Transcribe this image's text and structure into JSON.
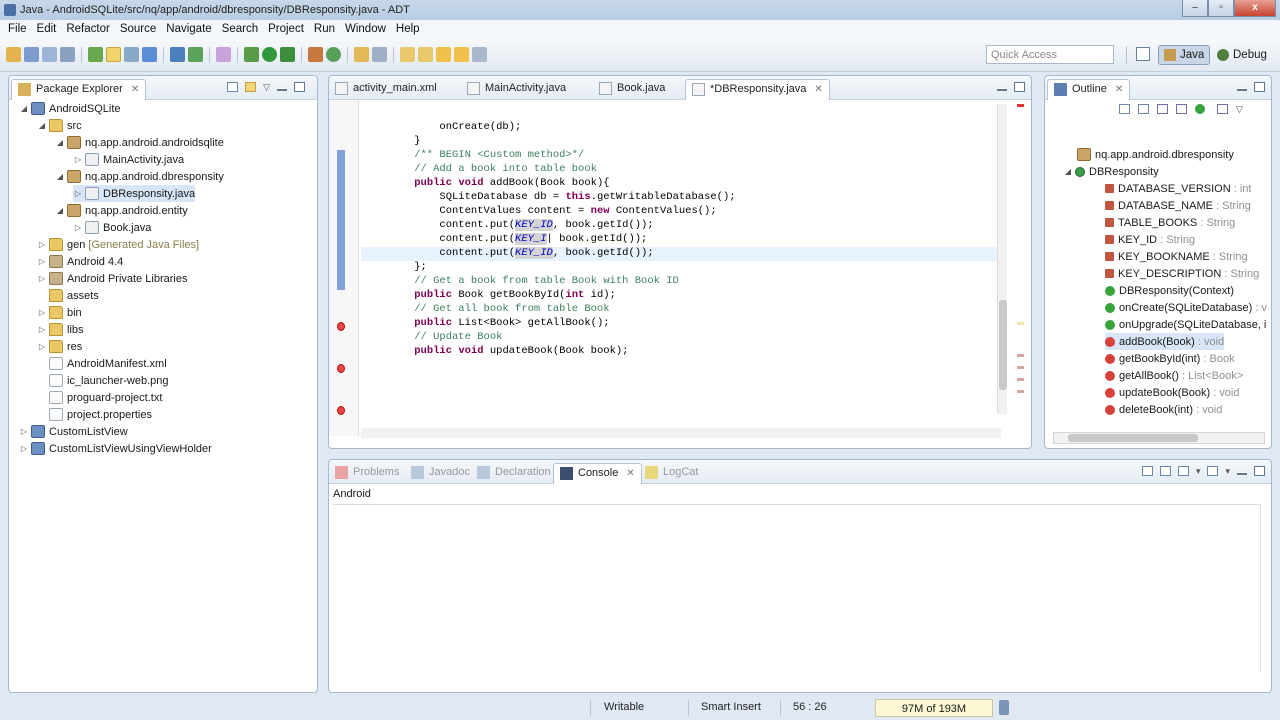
{
  "window": {
    "title": "Java - AndroidSQLite/src/nq/app/android/dbresponsity/DBResponsity.java - ADT",
    "controls": [
      "–",
      "▫",
      "x"
    ]
  },
  "menu": [
    "File",
    "Edit",
    "Refactor",
    "Source",
    "Navigate",
    "Search",
    "Project",
    "Run",
    "Window",
    "Help"
  ],
  "toolbar": {
    "quick_access_placeholder": "Quick Access",
    "perspective_java": "Java",
    "perspective_debug": "Debug"
  },
  "explorer": {
    "title": "Package Explorer",
    "items": [
      {
        "label": "AndroidSQLite",
        "extra": ""
      },
      {
        "label": "src",
        "extra": ""
      },
      {
        "label": "nq.app.android.androidsqlite",
        "extra": ""
      },
      {
        "label": "MainActivity.java",
        "extra": ""
      },
      {
        "label": "nq.app.android.dbresponsity",
        "extra": ""
      },
      {
        "label": "DBResponsity.java",
        "extra": ""
      },
      {
        "label": "nq.app.android.entity",
        "extra": ""
      },
      {
        "label": "Book.java",
        "extra": ""
      },
      {
        "label": "gen",
        "extra": "[Generated Java Files]"
      },
      {
        "label": "Android 4.4",
        "extra": ""
      },
      {
        "label": "Android Private Libraries",
        "extra": ""
      },
      {
        "label": "assets",
        "extra": ""
      },
      {
        "label": "bin",
        "extra": ""
      },
      {
        "label": "libs",
        "extra": ""
      },
      {
        "label": "res",
        "extra": ""
      },
      {
        "label": "AndroidManifest.xml",
        "extra": ""
      },
      {
        "label": "ic_launcher-web.png",
        "extra": ""
      },
      {
        "label": "proguard-project.txt",
        "extra": ""
      },
      {
        "label": "project.properties",
        "extra": ""
      },
      {
        "label": "CustomListView",
        "extra": ""
      },
      {
        "label": "CustomListViewUsingViewHolder",
        "extra": ""
      }
    ]
  },
  "editor": {
    "tabs": [
      "activity_main.xml",
      "MainActivity.java",
      "Book.java",
      "*DBResponsity.java"
    ],
    "lines": [
      "        onCreate(db);",
      "    }",
      "",
      "    /** BEGIN <Custom method>*/",
      "    // Add a book into table book",
      "    public void addBook(Book book){",
      "        SQLiteDatabase db = this.getWritableDatabase();",
      "",
      "        ContentValues content = new ContentValues();",
      "        content.put(KEY_ID, book.getId());",
      "        content.put(KEY_I| book.getId());",
      "        content.put(KEY_ID, book.getId());",
      "    };",
      "",
      "    // Get a book from table Book with Book ID",
      "    public Book getBookById(int id);",
      "",
      "    // Get all book from table Book",
      "    public List<Book> getAllBook();",
      "",
      "    // Update Book",
      "    public void updateBook(Book book);"
    ]
  },
  "outline": {
    "title": "Outline",
    "items": [
      {
        "label": "nq.app.android.dbresponsity",
        "type": ""
      },
      {
        "label": "DBResponsity",
        "type": ""
      },
      {
        "label": "DATABASE_VERSION",
        "type": ": int"
      },
      {
        "label": "DATABASE_NAME",
        "type": ": String"
      },
      {
        "label": "TABLE_BOOKS",
        "type": ": String"
      },
      {
        "label": "KEY_ID",
        "type": ": String"
      },
      {
        "label": "KEY_BOOKNAME",
        "type": ": String"
      },
      {
        "label": "KEY_DESCRIPTION",
        "type": ": String"
      },
      {
        "label": "DBResponsity(Context)",
        "type": ""
      },
      {
        "label": "onCreate(SQLiteDatabase)",
        "type": ": v"
      },
      {
        "label": "onUpgrade(SQLiteDatabase, i",
        "type": ""
      },
      {
        "label": "addBook(Book)",
        "type": ": void"
      },
      {
        "label": "getBookById(int)",
        "type": ": Book"
      },
      {
        "label": "getAllBook()",
        "type": ": List<Book>"
      },
      {
        "label": "updateBook(Book)",
        "type": ": void"
      },
      {
        "label": "deleteBook(int)",
        "type": ": void"
      }
    ]
  },
  "bottom": {
    "tabs": [
      "Problems",
      "Javadoc",
      "Declaration",
      "Console",
      "LogCat"
    ],
    "console_title": "Android"
  },
  "status": {
    "writable": "Writable",
    "insert_mode": "Smart Insert",
    "position": "56 : 26",
    "memory": "97M of 193M"
  },
  "colors": {
    "keyword": "#7f0055",
    "comment": "#3f7f5f",
    "constant": "#0000c0",
    "chrome": "#dfe8f3"
  }
}
